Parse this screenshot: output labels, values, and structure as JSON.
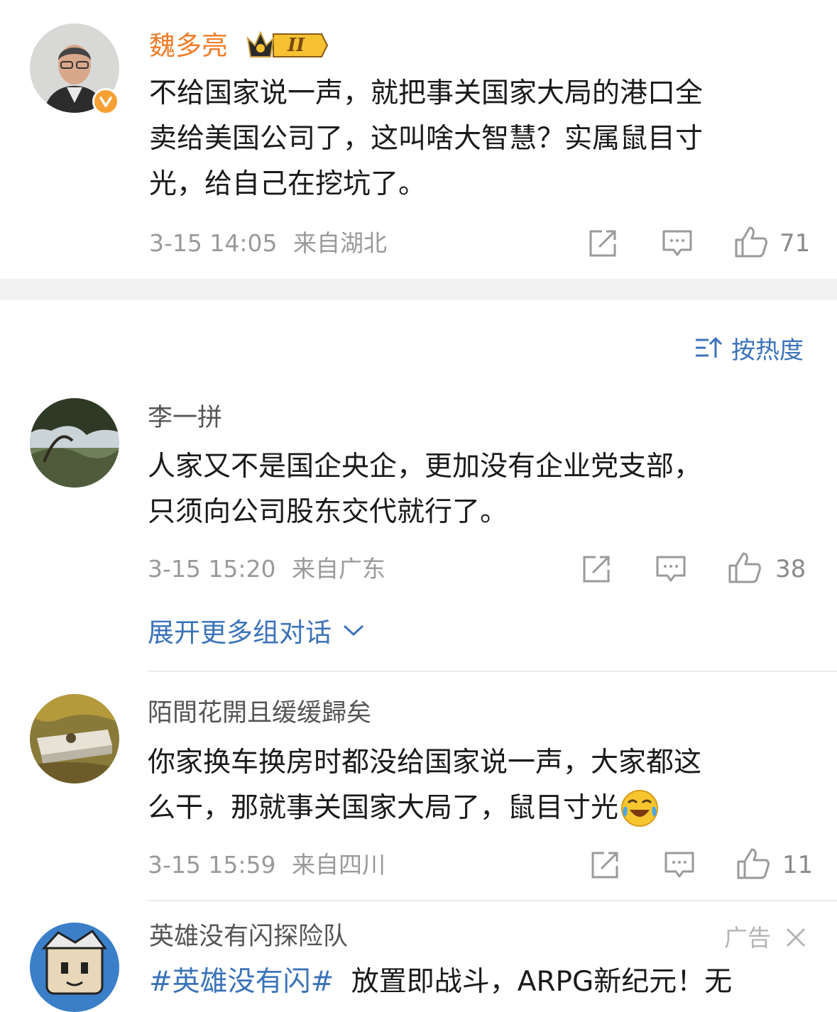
{
  "post": {
    "author": "魏多亮",
    "badge_level": "II",
    "text_lines": [
      "不给国家说一声，就把事关国家大局的港口全",
      "卖给美国公司了，这叫啥大智慧？实属鼠目寸",
      "光，给自己在挖坑了。"
    ],
    "time": "3-15 14:05",
    "location": "来自湖北",
    "likes": "71"
  },
  "sort": {
    "label": "按热度"
  },
  "comments": [
    {
      "author": "李一拼",
      "text_lines": [
        "人家又不是国企央企，更加没有企业党支部，",
        "只须向公司股东交代就行了。"
      ],
      "time": "3-15 15:20",
      "location": "来自广东",
      "likes": "38",
      "expand_label": "展开更多组对话"
    },
    {
      "author": "陌間花開且缓缓歸矣",
      "text_lines": [
        "你家换车换房时都没给国家说一声，大家都这",
        "么干，那就事关国家大局了，鼠目寸光"
      ],
      "time": "3-15 15:59",
      "location": "来自四川",
      "likes": "11"
    }
  ],
  "ad": {
    "author": "英雄没有闪探险队",
    "ad_label": "广告",
    "hashtag": "#英雄没有闪#",
    "text": "放置即战斗，ARPG新纪元！无"
  },
  "colors": {
    "accent_orange": "#f07c28",
    "link_blue": "#3b73b9",
    "meta_gray": "#9a9a9a"
  },
  "icons": [
    "verified-icon",
    "crown-badge-icon",
    "share-icon",
    "comment-icon",
    "like-icon",
    "sort-icon",
    "chevron-down-icon",
    "laugh-cry-emoji-icon",
    "close-icon"
  ]
}
